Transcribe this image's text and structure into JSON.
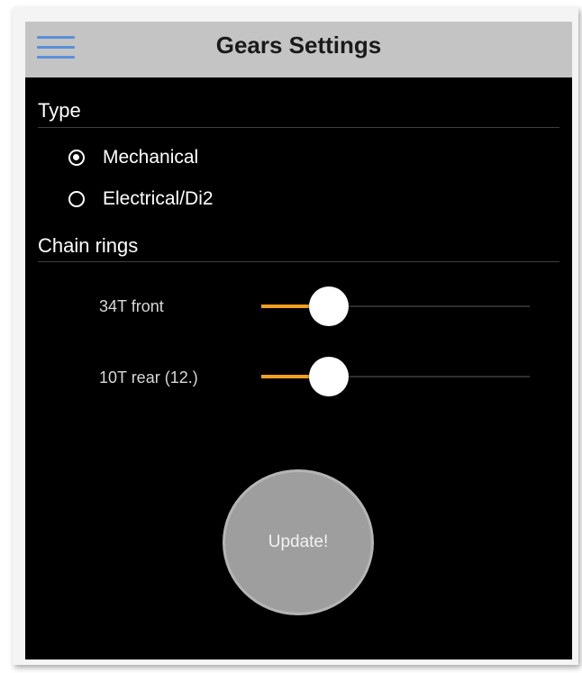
{
  "header": {
    "title": "Gears Settings",
    "menu_icon": "hamburger-menu-icon"
  },
  "type_section": {
    "label": "Type",
    "options": [
      {
        "label": "Mechanical",
        "selected": true
      },
      {
        "label": "Electrical/Di2",
        "selected": false
      }
    ]
  },
  "chain_rings_section": {
    "label": "Chain rings",
    "sliders": [
      {
        "label": "34T front",
        "value_fraction": 0.25
      },
      {
        "label": "10T rear (12.)",
        "value_fraction": 0.25
      }
    ]
  },
  "update_button": {
    "label": "Update!"
  },
  "colors": {
    "header_bg": "#c4c4c4",
    "menu_icon": "#5b8fd8",
    "screen_bg": "#000000",
    "slider_fill": "#f0a020",
    "button_bg": "#9e9e9e"
  }
}
